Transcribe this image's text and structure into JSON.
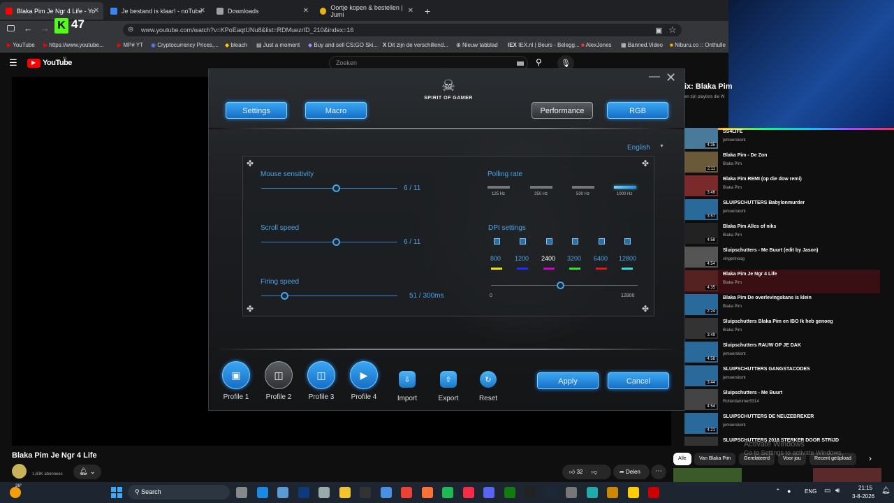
{
  "browser": {
    "tabs": [
      {
        "label": "Blaka Pim Je Ngr 4 Life - Yo",
        "active": true,
        "color": "#ff0000"
      },
      {
        "label": "Je bestand is klaar! - noTube",
        "active": false,
        "color": "#3b82f6"
      },
      {
        "label": "Downloads",
        "active": false,
        "color": "#9aa0a6"
      },
      {
        "label": "Oortje kopen & bestellen | Jumi",
        "active": false,
        "color": "#eab308"
      }
    ],
    "kick_count": "47",
    "url": "www.youtube.com/watch?v=KPoEaqtUNu8&list=RDMuezrID_210&index=16",
    "bookmarks": [
      "YouTube",
      "https://www.youtube...",
      "MP# YT",
      "Cryptocurrency Prices,...",
      "bleach",
      "Just a moment",
      "Buy and sell CS:GO Ski...",
      "Dit zijn de verschillend...",
      "Nieuw tabblad",
      "IEX.nl | Beurs - Belegg...",
      "AlexJones",
      "Banned.Video",
      "Niburu.co :: Onthulle"
    ]
  },
  "youtube": {
    "logo": "YouTube",
    "logo_country": "NL",
    "search_placeholder": "Zoeken",
    "video_title": "Blaka Pim Je Ngr 4 Life",
    "subscribers": "1,63K abonnees",
    "likes": "32",
    "share_label": "Delen",
    "playlist_header": "ix: Blaka Pim",
    "playlist_sub": "en zijn playlists die W",
    "chips": [
      "Alle",
      "Van Blaka Pim",
      "Gerelateerd",
      "Voor jou",
      "Recent geüpload"
    ],
    "watermark_line1": "Activate Windows",
    "watermark_line2": "Go to Settings to activate Windows."
  },
  "app": {
    "brand": "SPIRIT OF GAMER",
    "nav": [
      "Settings",
      "Macro",
      "Performance",
      "RGB"
    ],
    "language": "English",
    "mouse_sensitivity": {
      "label": "Mouse sensitivity",
      "value": "6 / 11",
      "level": 0.55
    },
    "scroll_speed": {
      "label": "Scroll speed",
      "value": "6 / 11",
      "level": 0.55
    },
    "firing_speed": {
      "label": "Firing speed",
      "value": "51 / 300ms",
      "level": 0.17
    },
    "polling_rate": {
      "label": "Polling rate",
      "options": [
        "125 Hz",
        "250 Hz",
        "500 Hz",
        "1000 Hz"
      ],
      "selected": 3
    },
    "dpi": {
      "label": "DPI settings",
      "values": [
        "800",
        "1200",
        "2400",
        "3200",
        "6400",
        "12800"
      ],
      "colors": [
        "#f7e400",
        "#1f2bff",
        "#d000d0",
        "#2ce82c",
        "#e01a1a",
        "#30e0e0"
      ],
      "min": "0",
      "max": "12800",
      "level": 0.47
    },
    "profiles": [
      "Profile 1",
      "Profile 2",
      "Profile 3",
      "Profile 4"
    ],
    "actions": [
      "Import",
      "Export",
      "Reset"
    ],
    "apply": "Apply",
    "cancel": "Cancel"
  },
  "playlist": [
    {
      "title": "SS4LIFE",
      "channel": "jemoerskont",
      "duration": "4:35"
    },
    {
      "title": "Blaka Pim - De Zon",
      "channel": "Blaka Pim",
      "duration": "2:11"
    },
    {
      "title": "Blaka Pim REMI (op die dow remi)",
      "channel": "Blaka Pim",
      "duration": "3:46"
    },
    {
      "title": "SLUIPSCHUTTERS Babylonmurder",
      "channel": "jemoerskont",
      "duration": "3:57"
    },
    {
      "title": "Blaka Pim Alles of niks",
      "channel": "Blaka Pim",
      "duration": "4:58"
    },
    {
      "title": "Sluipschutters - Me Buurt (edit by Jason)",
      "channel": "vingerinoog",
      "duration": "4:54"
    },
    {
      "title": "Blaka Pim Je Ngr 4 Life",
      "channel": "Blaka Pim",
      "duration": "4:35",
      "active": true
    },
    {
      "title": "Blaka Pim De overlevingskans is klein",
      "channel": "Blaka Pim",
      "duration": "2:24"
    },
    {
      "title": "Sluipschutters Blaka Pim en IBO Ik heb genoeg",
      "channel": "Blaka Pim",
      "duration": "3:49"
    },
    {
      "title": "Sluipschutters RAUW OP JE DAK",
      "channel": "jemoerskont",
      "duration": "4:58"
    },
    {
      "title": "SLUIPSCHUTTERS GANGSTACODES",
      "channel": "jemoerskont",
      "duration": "3:44"
    },
    {
      "title": "Sluipschutters - Me Buurt",
      "channel": "Rotterdammer5314",
      "duration": "4:54"
    },
    {
      "title": "SLUIPSCHUTTERS DE NEUZEBREKER",
      "channel": "jemoerskont",
      "duration": "4:21"
    },
    {
      "title": "SLUIPSCHUTTERS 2018 STERKER DOOR STRIJD",
      "channel": "",
      "duration": ""
    }
  ],
  "taskbar": {
    "weather": "26°",
    "search": "Search",
    "lang": "ENG",
    "time": "21:15",
    "date": "3-8-2026"
  }
}
